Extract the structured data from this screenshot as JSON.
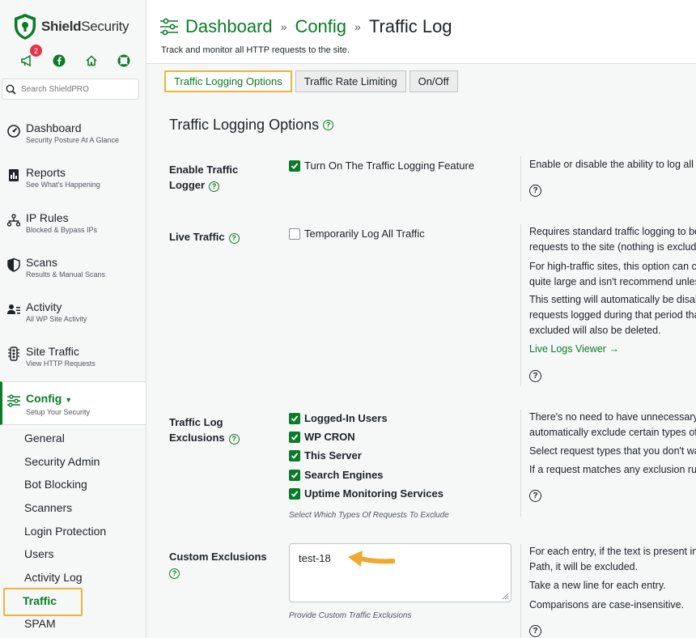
{
  "brand": {
    "name_bold": "Shield",
    "name_light": "Security"
  },
  "notifications": {
    "count": "2"
  },
  "search": {
    "placeholder": "Search ShieldPRO"
  },
  "nav": [
    {
      "title": "Dashboard",
      "sub": "Security Posture At A Glance"
    },
    {
      "title": "Reports",
      "sub": "See What's Happening"
    },
    {
      "title": "IP Rules",
      "sub": "Blocked & Bypass IPs"
    },
    {
      "title": "Scans",
      "sub": "Results & Manual Scans"
    },
    {
      "title": "Activity",
      "sub": "All WP Site Activity"
    },
    {
      "title": "Site Traffic",
      "sub": "View HTTP Requests"
    },
    {
      "title": "Config",
      "sub": "Setup Your Security"
    }
  ],
  "subnav": [
    "General",
    "Security Admin",
    "Bot Blocking",
    "Scanners",
    "Login Protection",
    "Users",
    "Activity Log",
    "Traffic",
    "SPAM"
  ],
  "breadcrumb": {
    "dashboard": "Dashboard",
    "config": "Config",
    "current": "Traffic Log",
    "sep": "»"
  },
  "page_desc": "Track and monitor all HTTP requests to the site.",
  "tabs": [
    "Traffic Logging Options",
    "Traffic Rate Limiting",
    "On/Off"
  ],
  "section_title": "Traffic Logging Options",
  "options": {
    "enable": {
      "label": "Enable Traffic Logger",
      "checkbox": "Turn On The Traffic Logging Feature",
      "checked": true,
      "desc": [
        "Enable or disable the ability to log all"
      ]
    },
    "live": {
      "label": "Live Traffic",
      "checkbox": "Temporarily Log All Traffic",
      "checked": false,
      "desc": [
        "Requires standard traffic logging to be",
        "requests to the site (nothing is excluded",
        "For high-traffic sites, this option can ca",
        "quite large and isn't recommend unless",
        "This setting will automatically be disabl",
        "requests logged during that period that",
        "excluded will also be deleted."
      ],
      "link": "Live Logs Viewer →"
    },
    "exclusions": {
      "label": "Traffic Log Exclusions",
      "items": [
        "Logged-In Users",
        "WP CRON",
        "This Server",
        "Search Engines",
        "Uptime Monitoring Services"
      ],
      "helper": "Select Which Types Of Requests To Exclude",
      "desc": [
        "There's no need to have unnecessary tra",
        "automatically exclude certain types of",
        "Select request types that you don't wan",
        "If a request matches any exclusion rule"
      ]
    },
    "custom": {
      "label": "Custom Exclusions",
      "value": "test-18",
      "helper": "Provide Custom Traffic Exclusions",
      "desc": [
        "For each entry, if the text is present in",
        "Path, it will be excluded.",
        "Take a new line for each entry.",
        "Comparisons are case-insensitive."
      ]
    }
  },
  "help_glyph": "?",
  "colors": {
    "accent": "#0a7c27",
    "highlight": "#f0b43c",
    "badge": "#e2344c"
  }
}
